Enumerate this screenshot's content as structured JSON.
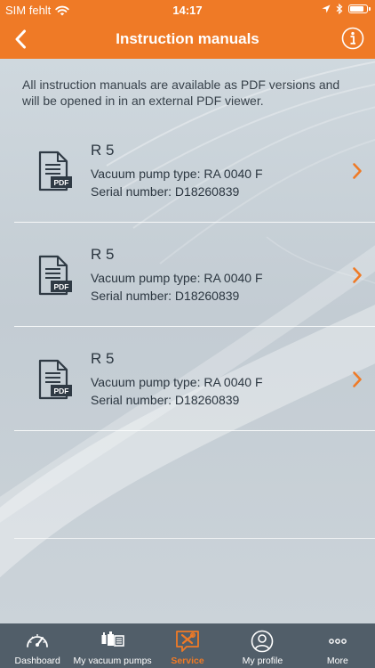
{
  "status_bar": {
    "carrier": "SIM fehlt",
    "time": "14:17",
    "battery_level": 0.85
  },
  "nav": {
    "title": "Instruction manuals"
  },
  "intro": "All instruction manuals are available as PDF versions and will be opened in in an external PDF viewer.",
  "manuals": [
    {
      "title": "R 5",
      "type": "Vacuum pump type: RA 0040 F",
      "serial": "Serial number: D18260839",
      "icon_label": "PDF"
    },
    {
      "title": "R 5",
      "type": "Vacuum pump type: RA 0040 F",
      "serial": "Serial number: D18260839",
      "icon_label": "PDF"
    },
    {
      "title": "R 5",
      "type": "Vacuum pump type: RA 0040 F",
      "serial": "Serial number: D18260839",
      "icon_label": "PDF"
    }
  ],
  "tabs": [
    {
      "label": "Dashboard",
      "icon": "gauge-icon"
    },
    {
      "label": "My vacuum pumps",
      "icon": "pumps-icon"
    },
    {
      "label": "Service",
      "icon": "service-tools-icon",
      "active": true
    },
    {
      "label": "My profile",
      "icon": "profile-icon"
    },
    {
      "label": "More",
      "icon": "more-dots-icon"
    }
  ],
  "colors": {
    "accent": "#ef7a26",
    "tab_bar": "#515e69",
    "text": "#2b3640"
  }
}
